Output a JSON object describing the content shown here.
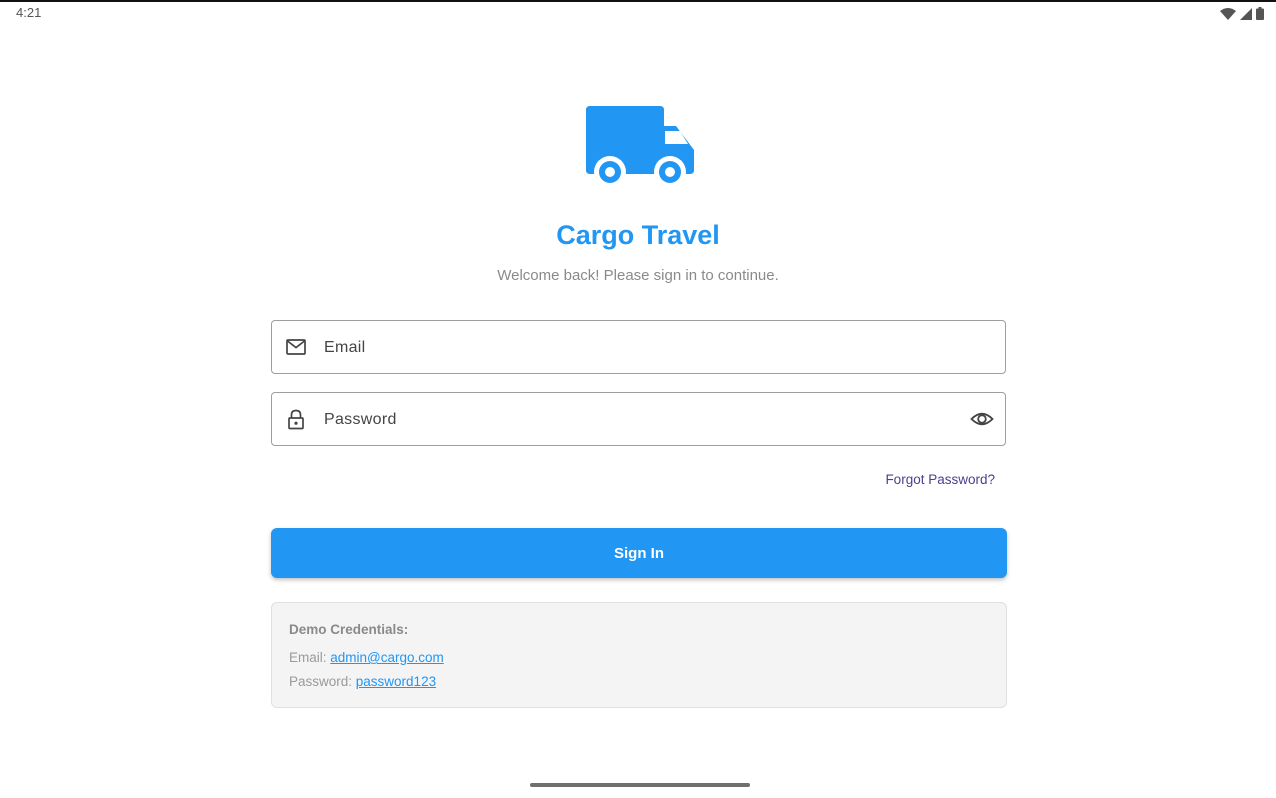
{
  "status_bar": {
    "time": "4:21",
    "icons": [
      "wifi-icon",
      "signal-icon",
      "battery-icon"
    ]
  },
  "branding": {
    "logo_icon": "truck-icon",
    "title": "Cargo Travel",
    "subtitle": "Welcome back! Please sign in to continue."
  },
  "form": {
    "email_label": "Email",
    "email_icon": "mail-icon",
    "password_label": "Password",
    "password_icon": "lock-icon",
    "visibility_icon": "eye-icon",
    "forgot_password": "Forgot Password?",
    "submit_label": "Sign In"
  },
  "demo": {
    "title": "Demo Credentials:",
    "email_prefix": "Email: ",
    "email_value": "admin@cargo.com",
    "password_prefix": "Password: ",
    "password_value": "password123"
  },
  "colors": {
    "primary": "#2196F3",
    "subtitle": "#8a8a8a",
    "link_forgot": "#4a3f8f",
    "demo_background": "#f4f4f4"
  }
}
